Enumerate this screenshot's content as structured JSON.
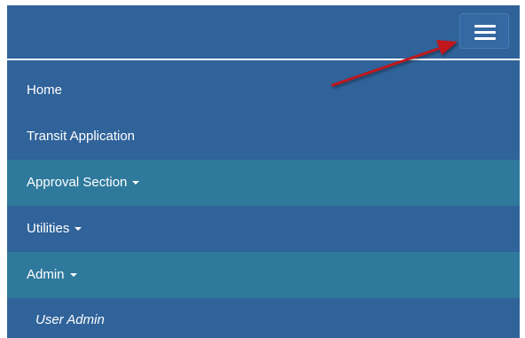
{
  "navbar": {
    "toggle_icon": "hamburger-menu-icon"
  },
  "menu": {
    "items": [
      {
        "label": "Home",
        "dropdown": false
      },
      {
        "label": "Transit Application",
        "dropdown": false
      },
      {
        "label": "Approval Section",
        "dropdown": true
      },
      {
        "label": "Utilities",
        "dropdown": true
      },
      {
        "label": "Admin",
        "dropdown": true
      }
    ],
    "subitems": [
      {
        "label": "User Admin"
      }
    ]
  },
  "annotation": {
    "arrow_color": "#c0191c"
  },
  "colors": {
    "navbar_bg": "#30639a",
    "highlight_bg": "#2f7a9c",
    "text": "#ffffff"
  }
}
